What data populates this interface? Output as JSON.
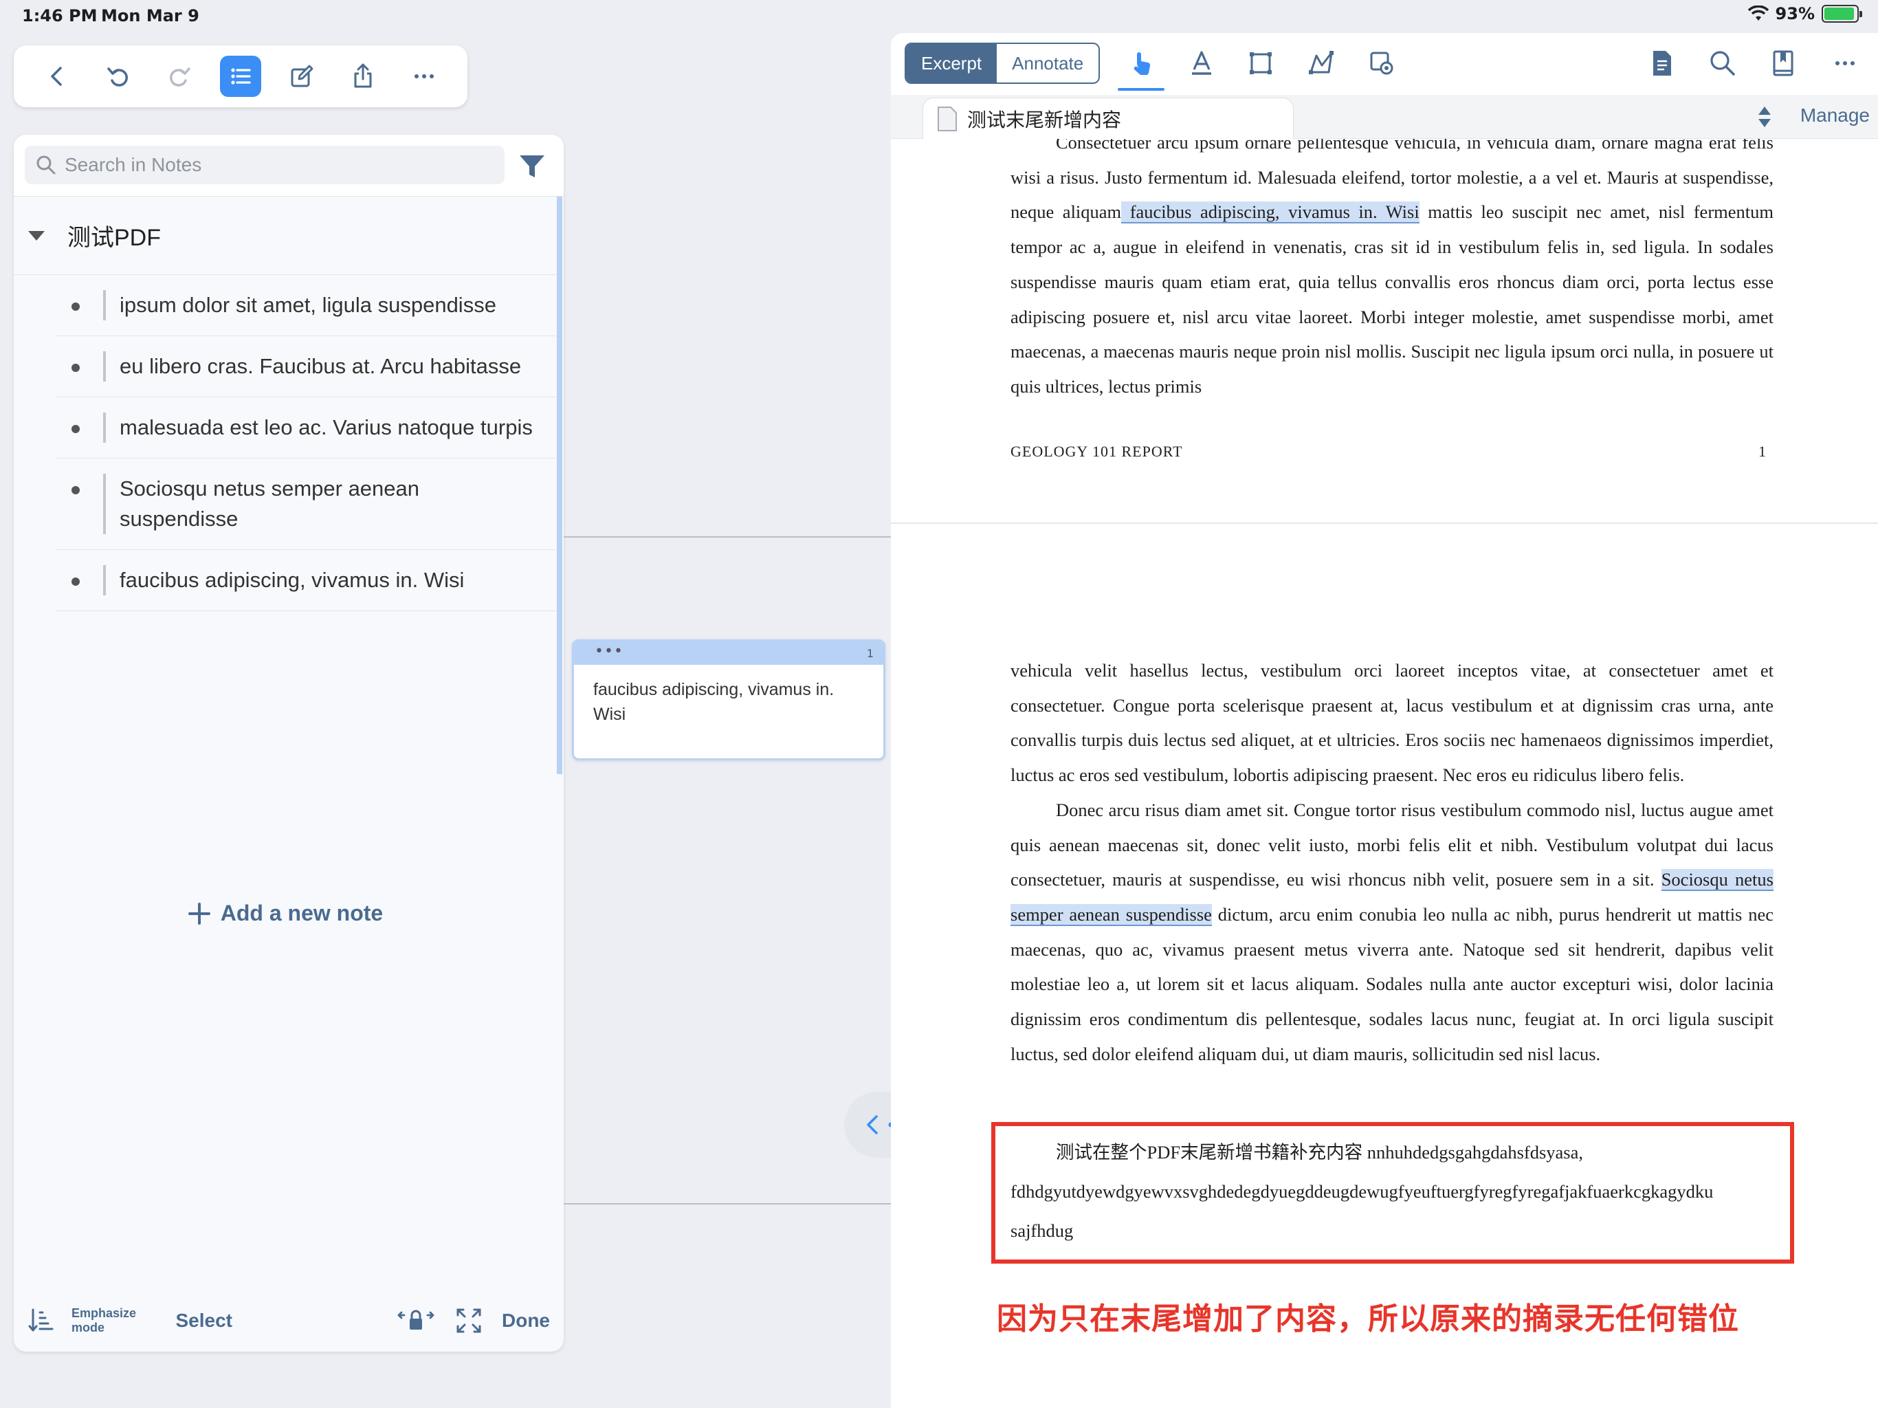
{
  "status": {
    "time": "1:46 PM",
    "date": "Mon Mar 9",
    "battery": "93%",
    "battery_level": 0.93
  },
  "left_toolbar": {
    "icons": [
      "back-icon",
      "undo-icon",
      "redo-icon",
      "outline-list-icon",
      "edit-icon",
      "share-icon",
      "more-icon"
    ],
    "accent": "#3a8ef6"
  },
  "notes": {
    "search_placeholder": "Search in Notes",
    "notebook_title": "测试PDF",
    "items": [
      {
        "text": "ipsum dolor sit amet, ligula suspendisse"
      },
      {
        "text": "eu libero cras. Faucibus at. Arcu habitasse"
      },
      {
        "text": "malesuada est leo ac. Varius natoque turpis"
      },
      {
        "text": "Sociosqu netus semper aenean suspendisse"
      },
      {
        "text": "faucibus adipiscing, vivamus in. Wisi"
      }
    ],
    "add_note": "Add a new note",
    "bottom": {
      "emphasize": "Emphasize mode",
      "select": "Select",
      "done": "Done"
    }
  },
  "card": {
    "dots": "•••",
    "page": "1",
    "text": "faucibus adipiscing, vivamus in. Wisi"
  },
  "doc": {
    "seg_excerpt": "Excerpt",
    "seg_annotate": "Annotate",
    "tab_title": "测试末尾新增内容",
    "manage": "Manage",
    "p1_l1": "Consectetuer arcu ipsum ornare pellentesque vehicula, in vehicula diam, ornare magna erat felis wisi a risus. Justo fermentum id. Malesuada eleifend, tortor molestie, a a vel et. Mauris at suspendisse, neque aliquam",
    "p1_hl": " faucibus adipiscing, vivamus in. Wisi",
    "p1_rest": " mattis leo suscipit nec amet, nisl fermentum tempor ac a, augue in eleifend in venenatis, cras sit id in vestibulum felis in, sed ligula. In sodales suspendisse mauris quam etiam erat, quia tellus convallis eros rhoncus diam orci, porta lectus esse adipiscing posuere et, nisl arcu vitae laoreet. Morbi integer molestie, amet suspendisse morbi, amet maecenas, a maecenas mauris neque proin nisl mollis. Suscipit nec ligula ipsum orci nulla, in posuere ut quis ultrices, lectus primis",
    "footer_left": "GEOLOGY 101 REPORT",
    "footer_right": "1",
    "p2": "vehicula velit hasellus lectus, vestibulum orci laoreet inceptos vitae, at consectetuer amet et consectetuer. Congue porta scelerisque praesent at, lacus vestibulum et at dignissim cras urna, ante convallis turpis duis lectus sed aliquet, at et ultricies. Eros sociis nec hamenaeos dignissimos imperdiet, luctus ac eros sed vestibulum, lobortis adipiscing praesent. Nec eros eu ridiculus libero felis.",
    "p3_a": "Donec arcu risus diam amet sit. Congue tortor risus vestibulum commodo nisl, luctus augue amet quis aenean maecenas sit, donec velit iusto, morbi felis elit et nibh. Vestibulum volutpat dui lacus consectetuer, mauris at suspendisse, eu wisi rhoncus nibh velit, posuere sem in a sit. ",
    "p3_hl": "Sociosqu netus semper aenean suspendisse",
    "p3_b": " dictum, arcu enim conubia leo nulla ac nibh, purus hendrerit ut mattis nec maecenas, quo ac, vivamus praesent metus viverra ante. Natoque sed sit hendrerit, dapibus velit molestiae leo a, ut lorem sit et lacus aliquam. Sodales nulla ante auctor excepturi wisi, dolor lacinia dignissim eros condimentum dis pellentesque, sodales lacus nunc, feugiat at. In orci ligula suscipit luctus, sed dolor eleifend aliquam dui, ut diam mauris, sollicitudin sed nisl lacus.",
    "p4_l1": "测试在整个PDF末尾新增书籍补充内容 nnhuhdedgsgahgdahsfdsyasa,",
    "p4_l2": "fdhdgyutdyewdgyewvxsvghdedegdyuegddeugdewugfyeuftuergfyregfyregafjakfuaerkcgkagydku",
    "p4_l3": "sajfhdug",
    "annotation": "因为只在末尾增加了内容，所以原来的摘录无任何错位",
    "annotation_color": "#e8352a"
  }
}
